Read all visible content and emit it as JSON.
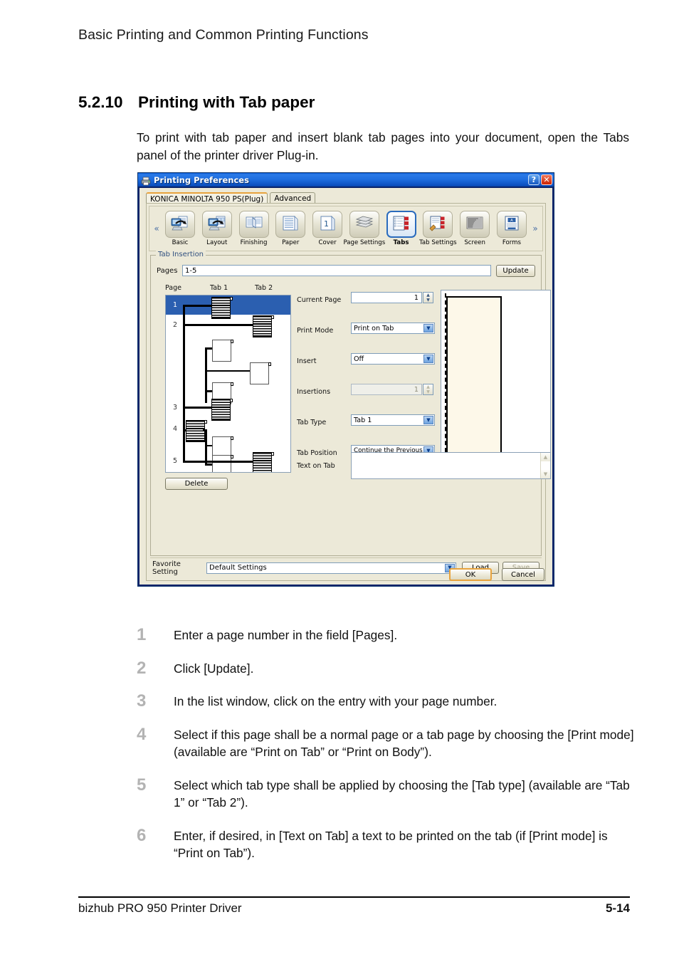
{
  "document": {
    "running_head": "Basic Printing and Common Printing Functions",
    "section_number": "5.2.10",
    "section_title": "Printing with Tab paper",
    "intro": "To print with tab paper and insert blank tab pages into your document, open the Tabs panel of the printer driver Plug-in.",
    "footer_left": "bizhub PRO 950 Printer Driver",
    "footer_right": "5-14"
  },
  "steps": [
    {
      "number": "1",
      "text": "Enter a page number in the field [Pages]."
    },
    {
      "number": "2",
      "text": "Click [Update]."
    },
    {
      "number": "3",
      "text": "In the list window, click on the entry with your page number."
    },
    {
      "number": "4",
      "text": "Select if this page shall be a normal page or a tab page by choosing the [Print mode] (available are “Print on Tab” or “Print on Body”)."
    },
    {
      "number": "5",
      "text": "Select which tab type shall be applied by choosing the [Tab type] (available are “Tab 1” or “Tab 2”)."
    },
    {
      "number": "6",
      "text": "Enter, if desired, in [Text on Tab] a text to be printed on the tab (if [Print mode] is “Print on Tab”)."
    }
  ],
  "dialog": {
    "title": "Printing Preferences",
    "titlebar_icon": "printer-icon",
    "help_button": "?",
    "close_button": "✕",
    "tabs": [
      {
        "label": "KONICA MINOLTA 950 PS(Plug)",
        "active": true
      },
      {
        "label": "Advanced",
        "active": false
      }
    ],
    "toolbar": {
      "prev_arrow": "«",
      "next_arrow": "»",
      "items": [
        {
          "label": "Basic",
          "icon": "basic-icon",
          "selected": false
        },
        {
          "label": "Layout",
          "icon": "layout-icon",
          "selected": false
        },
        {
          "label": "Finishing",
          "icon": "finishing-icon",
          "selected": false
        },
        {
          "label": "Paper",
          "icon": "paper-icon",
          "selected": false
        },
        {
          "label": "Cover",
          "icon": "cover-icon",
          "selected": false
        },
        {
          "label": "Page Settings",
          "icon": "page-settings-icon",
          "selected": false
        },
        {
          "label": "Tabs",
          "icon": "tabs-icon",
          "selected": true
        },
        {
          "label": "Tab Settings",
          "icon": "tab-settings-icon",
          "selected": false
        },
        {
          "label": "Screen",
          "icon": "screen-icon",
          "selected": false
        },
        {
          "label": "Forms",
          "icon": "forms-icon",
          "selected": false
        }
      ]
    },
    "tab_insertion": {
      "group_label": "Tab Insertion",
      "pages_label": "Pages",
      "pages_value": "1-5",
      "update_button": "Update",
      "list": {
        "col_page": "Page",
        "col_tab1": "Tab 1",
        "col_tab2": "Tab 2",
        "rows": [
          "1",
          "2",
          "3",
          "4",
          "5"
        ],
        "selected_row": "1"
      },
      "controls": [
        {
          "label": "Current Page",
          "value": "1",
          "type": "spinner",
          "disabled": false
        },
        {
          "label": "Print Mode",
          "value": "Print on Tab",
          "type": "dropdown",
          "disabled": false
        },
        {
          "label": "Insert",
          "value": "Off",
          "type": "dropdown",
          "disabled": false
        },
        {
          "label": "Insertions",
          "value": "1",
          "type": "spinner",
          "disabled": true
        },
        {
          "label": "Tab Type",
          "value": "Tab 1",
          "type": "dropdown",
          "disabled": false
        },
        {
          "label": "Tab Position",
          "value": "Continue the Previous P",
          "type": "dropdown",
          "disabled": false
        }
      ],
      "text_on_tab_label": "Text on Tab",
      "text_on_tab_value": "",
      "delete_button": "Delete"
    },
    "favorite": {
      "label": "Favorite Setting",
      "value": "Default Settings",
      "load_button": "Load",
      "save_button": "Save",
      "save_disabled": true
    },
    "ok_button": "OK",
    "cancel_button": "Cancel",
    "colors": {
      "titlebar": "#1f6fe0",
      "face": "#ece9d8",
      "selection": "#2b5fb0",
      "accent_orange": "#e8a33d",
      "preview_paper": "#fdf8e9"
    }
  }
}
